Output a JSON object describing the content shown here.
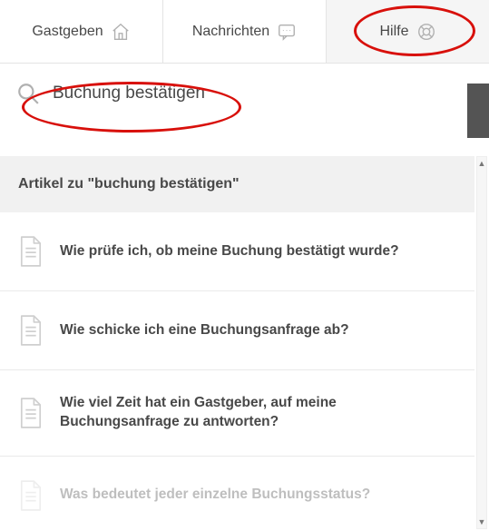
{
  "nav": {
    "host_label": "Gastgeben",
    "messages_label": "Nachrichten",
    "help_label": "Hilfe"
  },
  "search": {
    "query": "Buchung bestätigen"
  },
  "results": {
    "header": "Artikel zu \"buchung bestätigen\"",
    "items": [
      {
        "title": "Wie prüfe ich, ob meine Buchung bestätigt wurde?"
      },
      {
        "title": "Wie schicke ich eine Buchungsanfrage ab?"
      },
      {
        "title": "Wie viel Zeit hat ein Gastgeber, auf meine Buchungsanfrage zu antworten?"
      },
      {
        "title": "Was bedeutet jeder einzelne Buchungsstatus?"
      }
    ]
  }
}
